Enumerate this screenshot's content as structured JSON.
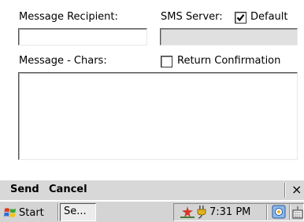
{
  "form": {
    "recipient_label": "Message Recipient:",
    "recipient_value": "",
    "sms_server_label": "SMS Server:",
    "sms_server_value": "",
    "default_label": "Default",
    "default_checked": true,
    "message_label": "Message - Chars:",
    "message_value": "",
    "return_confirmation_label": "Return Confirmation",
    "return_confirmation_checked": false
  },
  "menubar": {
    "send_label": "Send",
    "cancel_label": "Cancel",
    "close_glyph": "×"
  },
  "taskbar": {
    "start_label": "Start",
    "task_label": "Se...",
    "clock": "7:31 PM"
  }
}
